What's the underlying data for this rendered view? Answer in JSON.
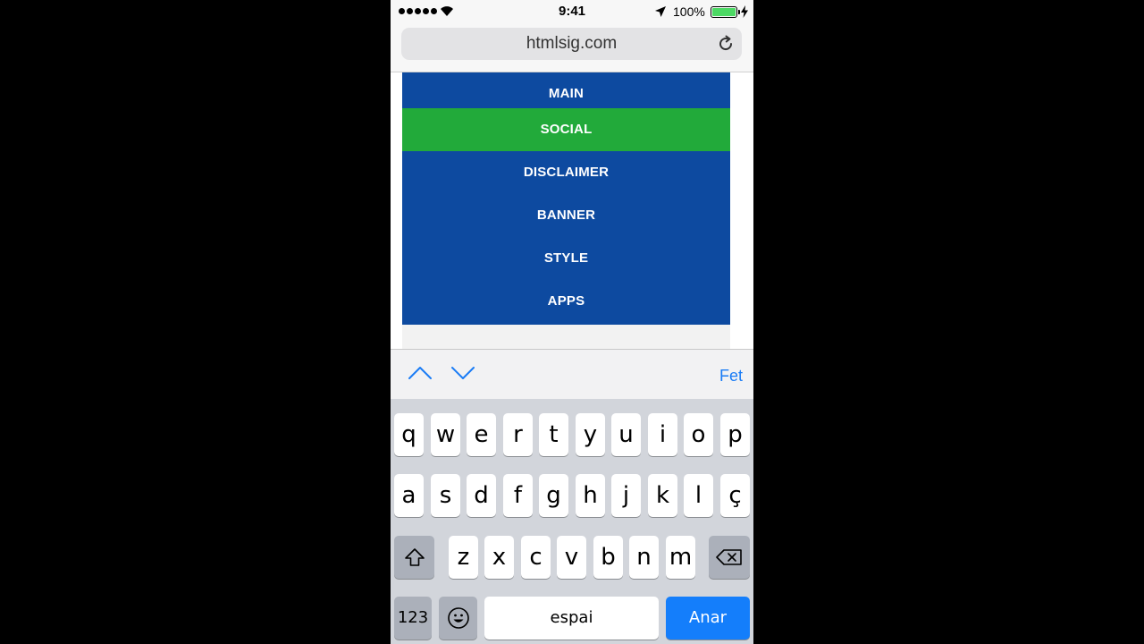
{
  "status_bar": {
    "time": "9:41",
    "battery": "100%"
  },
  "browser": {
    "url": "htmlsig.com"
  },
  "menu": {
    "items": [
      {
        "label": "MAIN",
        "active": false
      },
      {
        "label": "SOCIAL",
        "active": true
      },
      {
        "label": "DISCLAIMER",
        "active": false
      },
      {
        "label": "BANNER",
        "active": false
      },
      {
        "label": "STYLE",
        "active": false
      },
      {
        "label": "APPS",
        "active": false
      }
    ],
    "colors": {
      "panel": "#0d4aa0",
      "active": "#22aa3a"
    }
  },
  "accessory": {
    "done": "Fet"
  },
  "keyboard": {
    "row1": [
      "q",
      "w",
      "e",
      "r",
      "t",
      "y",
      "u",
      "i",
      "o",
      "p"
    ],
    "row2": [
      "a",
      "s",
      "d",
      "f",
      "g",
      "h",
      "j",
      "k",
      "l",
      "ç"
    ],
    "row3": [
      "z",
      "x",
      "c",
      "v",
      "b",
      "n",
      "m"
    ],
    "numbers": "123",
    "space": "espai",
    "go": "Anar"
  }
}
